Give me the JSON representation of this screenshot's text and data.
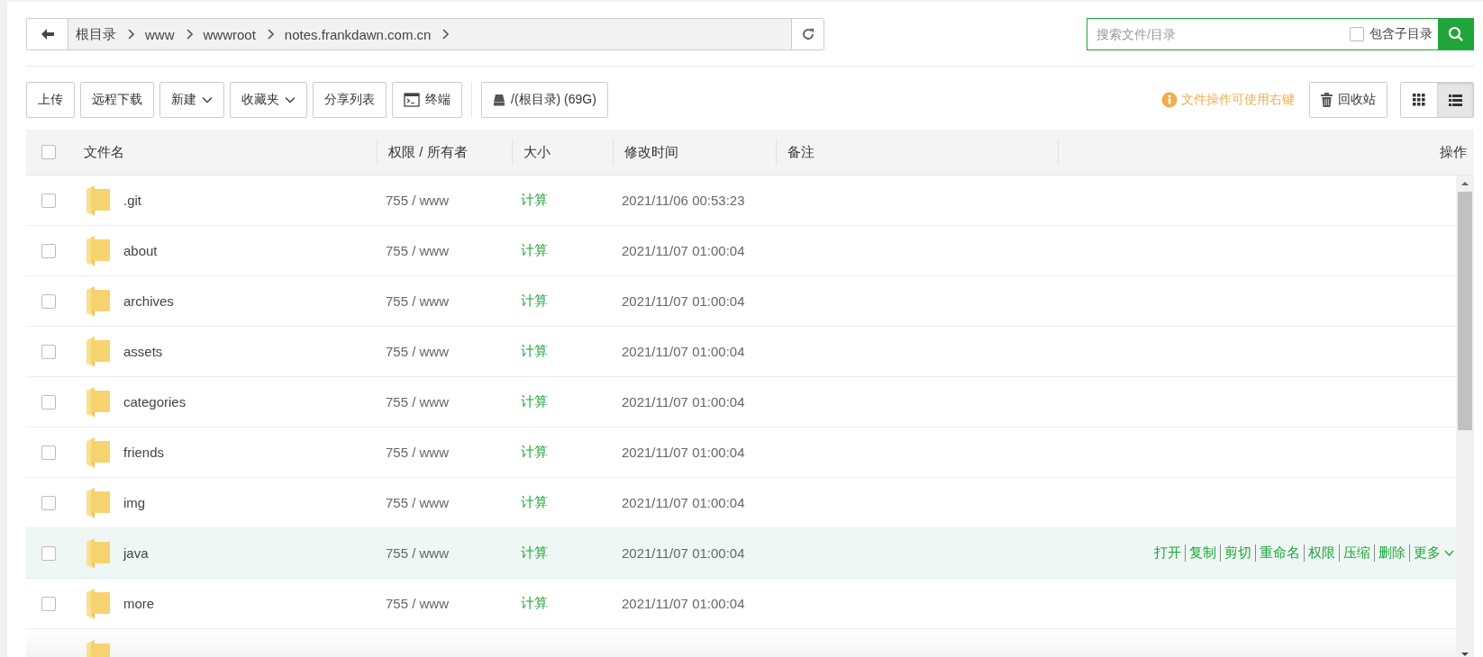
{
  "breadcrumb": {
    "segments": [
      "根目录",
      "www",
      "wwwroot",
      "notes.frankdawn.com.cn"
    ]
  },
  "search": {
    "placeholder": "搜索文件/目录",
    "include_subdirs": {
      "label": "包含子目录",
      "checked": false
    }
  },
  "toolbar": {
    "buttons": [
      {
        "label": "上传",
        "kind": "plain"
      },
      {
        "label": "远程下载",
        "kind": "plain"
      },
      {
        "label": "新建",
        "kind": "dropdown"
      },
      {
        "label": "收藏夹",
        "kind": "dropdown"
      },
      {
        "label": "分享列表",
        "kind": "plain"
      },
      {
        "label": "终端",
        "kind": "terminal"
      },
      {
        "label": "/(根目录) (69G)",
        "kind": "disk"
      }
    ],
    "hint": "文件操作可使用右键",
    "recycle": "回收站",
    "views": [
      {
        "kind": "grid",
        "selected": false
      },
      {
        "kind": "list",
        "selected": true
      }
    ]
  },
  "table": {
    "select_all_checked": false,
    "columns": [
      "文件名",
      "权限 / 所有者",
      "大小",
      "修改时间",
      "备注",
      "操作"
    ],
    "rows": [
      {
        "name": ".git",
        "perm": "755 / www",
        "size": "计算",
        "mtime": "2021/11/06 00:53:23",
        "checked": false,
        "hovered": false
      },
      {
        "name": "about",
        "perm": "755 / www",
        "size": "计算",
        "mtime": "2021/11/07 01:00:04",
        "checked": false,
        "hovered": false
      },
      {
        "name": "archives",
        "perm": "755 / www",
        "size": "计算",
        "mtime": "2021/11/07 01:00:04",
        "checked": false,
        "hovered": false
      },
      {
        "name": "assets",
        "perm": "755 / www",
        "size": "计算",
        "mtime": "2021/11/07 01:00:04",
        "checked": false,
        "hovered": false
      },
      {
        "name": "categories",
        "perm": "755 / www",
        "size": "计算",
        "mtime": "2021/11/07 01:00:04",
        "checked": false,
        "hovered": false
      },
      {
        "name": "friends",
        "perm": "755 / www",
        "size": "计算",
        "mtime": "2021/11/07 01:00:04",
        "checked": false,
        "hovered": false
      },
      {
        "name": "img",
        "perm": "755 / www",
        "size": "计算",
        "mtime": "2021/11/07 01:00:04",
        "checked": false,
        "hovered": false
      },
      {
        "name": "java",
        "perm": "755 / www",
        "size": "计算",
        "mtime": "2021/11/07 01:00:04",
        "checked": false,
        "hovered": true,
        "actions": [
          "打开",
          "复制",
          "剪切",
          "重命名",
          "权限",
          "压缩",
          "删除",
          "更多"
        ]
      },
      {
        "name": "more",
        "perm": "755 / www",
        "size": "计算",
        "mtime": "2021/11/07 01:00:04",
        "checked": false,
        "hovered": false
      }
    ]
  }
}
